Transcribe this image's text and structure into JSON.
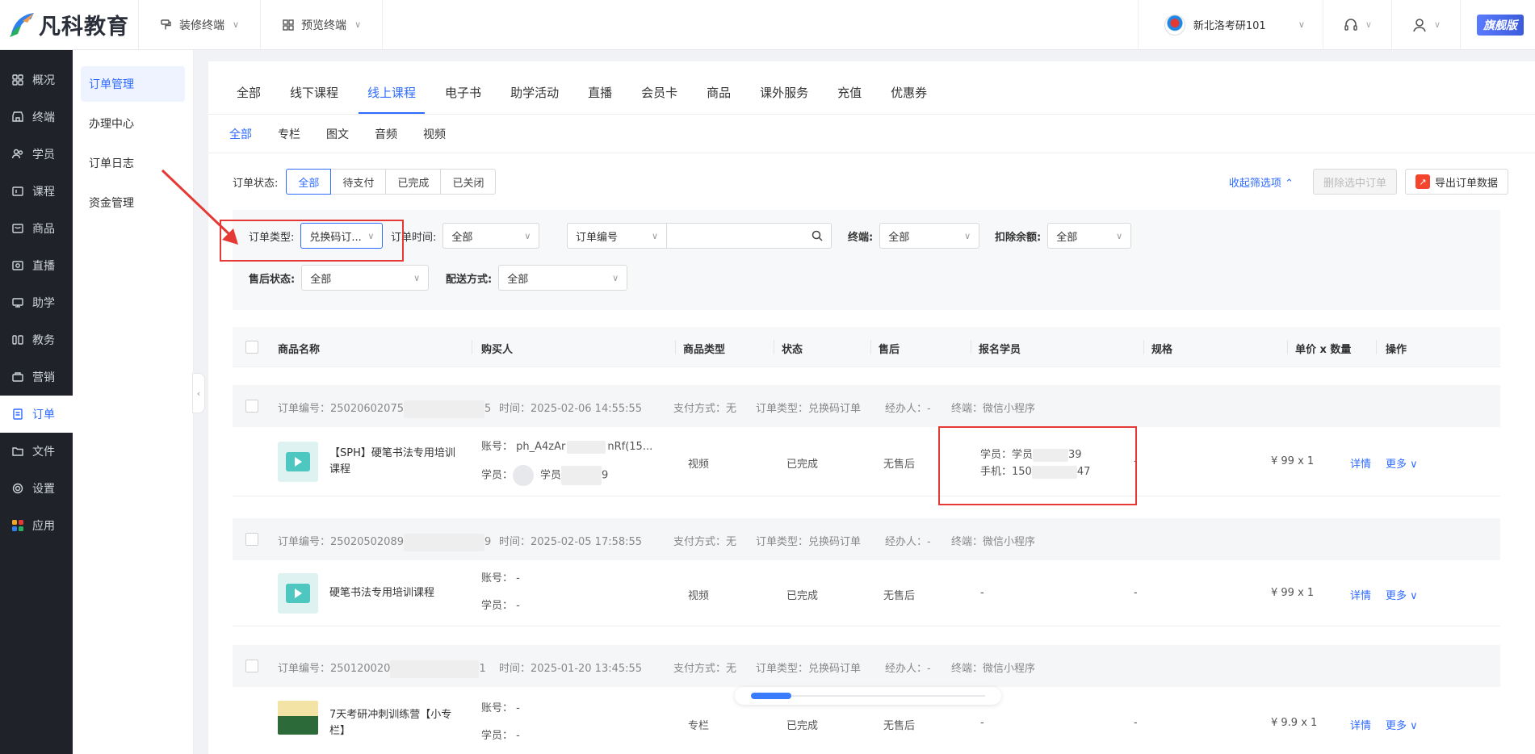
{
  "brand": {
    "name": "凡科教育"
  },
  "topbar": {
    "decorate_label": "装修终端",
    "preview_label": "预览终端",
    "school_name": "新北洛考研101",
    "vip_label": "旗舰版"
  },
  "sidebar": {
    "items": [
      {
        "label": "概况",
        "icon": "dashboard-icon"
      },
      {
        "label": "终端",
        "icon": "store-icon"
      },
      {
        "label": "学员",
        "icon": "users-icon"
      },
      {
        "label": "课程",
        "icon": "course-icon"
      },
      {
        "label": "商品",
        "icon": "goods-icon"
      },
      {
        "label": "直播",
        "icon": "live-icon"
      },
      {
        "label": "助学",
        "icon": "assist-icon"
      },
      {
        "label": "教务",
        "icon": "teaching-icon"
      },
      {
        "label": "营销",
        "icon": "marketing-icon"
      },
      {
        "label": "订单",
        "icon": "order-icon",
        "active": true
      },
      {
        "label": "文件",
        "icon": "folder-icon"
      },
      {
        "label": "设置",
        "icon": "gear-icon"
      },
      {
        "label": "应用",
        "icon": "apps-icon"
      }
    ]
  },
  "subnav": {
    "items": [
      {
        "label": "订单管理",
        "active": true
      },
      {
        "label": "办理中心"
      },
      {
        "label": "订单日志"
      },
      {
        "label": "资金管理"
      }
    ]
  },
  "tabs": {
    "primary": [
      "全部",
      "线下课程",
      "线上课程",
      "电子书",
      "助学活动",
      "直播",
      "会员卡",
      "商品",
      "课外服务",
      "充值",
      "优惠券"
    ],
    "primary_active": 2,
    "secondary": [
      "全部",
      "专栏",
      "图文",
      "音频",
      "视频"
    ],
    "secondary_active": 0
  },
  "status_filter": {
    "label": "订单状态:",
    "options": [
      "全部",
      "待支付",
      "已完成",
      "已关闭"
    ],
    "active": 0,
    "collapse_label": "收起筛选项",
    "delete_label": "删除选中订单",
    "export_label": "导出订单数据"
  },
  "filters": {
    "order_type": {
      "label": "订单类型:",
      "value": "兑换码订..."
    },
    "order_time": {
      "label": "订单时间:",
      "value": "全部"
    },
    "order_no": {
      "value": "订单编号"
    },
    "terminal": {
      "label": "终端:",
      "value": "全部"
    },
    "deduct": {
      "label": "扣除余额:",
      "value": "全部"
    },
    "after_sale": {
      "label": "售后状态:",
      "value": "全部"
    },
    "delivery": {
      "label": "配送方式:",
      "value": "全部"
    }
  },
  "table": {
    "headers": [
      "商品名称",
      "购买人",
      "商品类型",
      "状态",
      "售后",
      "报名学员",
      "规格",
      "单价 x 数量",
      "操作"
    ]
  },
  "orders": [
    {
      "no_prefix": "订单编号：25020602075",
      "no_suffix": "5",
      "time": "时间：2025-02-06 14:55:55",
      "pay": "支付方式：无",
      "type": "订单类型：兑换码订单",
      "agent": "经办人：-",
      "terminal": "终端：微信小程序",
      "product": "【SPH】硬笔书法专用培训课程",
      "account": "账号：  ph_A4zAr",
      "account_tail": "nRf(15...",
      "student_label": "学员：",
      "student_name": "学员",
      "student_tail": "9",
      "ptype": "视频",
      "status": "已完成",
      "after": "无售后",
      "enroll_student": "学员：学员",
      "enroll_student_tail": "39",
      "enroll_phone": "手机：150",
      "enroll_phone_tail": "47",
      "spec": "-",
      "price": "¥ 99 x 1",
      "detail": "详情",
      "more": "更多"
    },
    {
      "no_prefix": "订单编号：25020502089",
      "no_suffix": "9",
      "time": "时间：2025-02-05 17:58:55",
      "pay": "支付方式：无",
      "type": "订单类型：兑换码订单",
      "agent": "经办人：-",
      "terminal": "终端：微信小程序",
      "product": "硬笔书法专用培训课程",
      "account": "账号：  -",
      "student_label": "学员：  -",
      "ptype": "视频",
      "status": "已完成",
      "after": "无售后",
      "enroll": "-",
      "spec": "-",
      "price": "¥ 99 x 1",
      "detail": "详情",
      "more": "更多"
    },
    {
      "no_prefix": "订单编号：250120020",
      "no_suffix": "1",
      "time": "时间：2025-01-20 13:45:55",
      "pay": "支付方式：无",
      "type": "订单类型：兑换码订单",
      "agent": "经办人：-",
      "terminal": "终端：微信小程序",
      "product": "7天考研冲刺训练营【小专栏】",
      "account": "账号：  -",
      "student_label": "学员：  -",
      "ptype": "专栏",
      "status": "已完成",
      "after": "无售后",
      "enroll": "-",
      "spec": "-",
      "price": "¥ 9.9 x 1",
      "detail": "详情",
      "more": "更多"
    }
  ],
  "colors": {
    "accent": "#2f6bff",
    "sidebar_bg": "#1f2229",
    "annotation": "#e53935"
  }
}
